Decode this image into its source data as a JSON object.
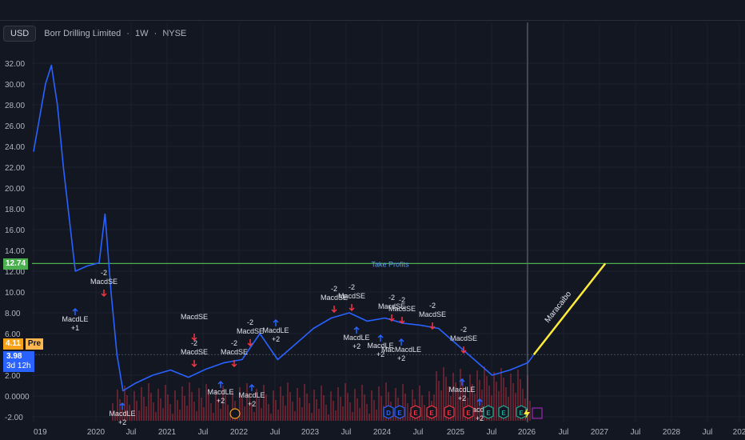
{
  "header": {
    "currency": "USD",
    "symbol_name": "Borr Drilling Limited",
    "interval": "1W",
    "exchange": "NYSE",
    "separator": "·"
  },
  "y_axis": {
    "ticks": [
      "32.00",
      "30.00",
      "28.00",
      "26.00",
      "24.00",
      "22.00",
      "20.00",
      "18.00",
      "16.00",
      "14.00",
      "12.00",
      "10.00",
      "8.00",
      "6.00",
      "2.00",
      "0.0000",
      "-2.00"
    ],
    "values": [
      32,
      30,
      28,
      26,
      24,
      22,
      20,
      18,
      16,
      14,
      12,
      10,
      8,
      6,
      2,
      0,
      -2
    ]
  },
  "x_axis": {
    "labels": [
      "019",
      "2020",
      "Jul",
      "2021",
      "Jul",
      "2022",
      "Jul",
      "2023",
      "Jul",
      "2024",
      "Jul",
      "2025",
      "Jul",
      "2026",
      "Jul",
      "2027",
      "Jul",
      "2028",
      "Jul",
      "202"
    ]
  },
  "price_tags": {
    "take_profit": "12.74",
    "prev_close": "4.11",
    "pre_label": "Pre",
    "last": "3.98",
    "countdown": "3d 12h"
  },
  "lines": {
    "take_profit_label": "Take Profits",
    "projection_label": "Maracaibo"
  },
  "colors": {
    "price_line": "#2962ff",
    "take_profit": "#4caf50",
    "projection": "#ffeb3b",
    "sell_arrow": "#f23645",
    "buy_arrow": "#2962ff",
    "background": "#131722"
  },
  "signals": [
    {
      "text": "-2",
      "sub": "MacdSE",
      "kind": "sell"
    },
    {
      "text": "MacdLE",
      "sub": "+1",
      "kind": "buy"
    },
    {
      "text": "MacdLE",
      "sub": "+2",
      "kind": "buy"
    },
    {
      "text": "-2",
      "sub": "MacdSE",
      "kind": "sell"
    },
    {
      "text": "MacdSE",
      "sub": "",
      "kind": "sell"
    },
    {
      "text": "-2",
      "sub": "MacdSE",
      "kind": "sell"
    },
    {
      "text": "-2",
      "sub": "MacdSE",
      "kind": "sell"
    },
    {
      "text": "MacdLE",
      "sub": "+2",
      "kind": "buy"
    },
    {
      "text": "MacdLE",
      "sub": "+2",
      "kind": "buy"
    },
    {
      "text": "MacdLE",
      "sub": "+2",
      "kind": "buy"
    },
    {
      "text": "-2",
      "sub": "MacdSE",
      "kind": "sell"
    },
    {
      "text": "-2",
      "sub": "MacdSE",
      "kind": "sell"
    },
    {
      "text": "MacdLE",
      "sub": "+2",
      "kind": "buy"
    },
    {
      "text": "-2",
      "sub": "MacdSE",
      "kind": "sell"
    },
    {
      "text": "-2",
      "sub": "MacdSE",
      "kind": "sell"
    },
    {
      "text": "MacdLE",
      "sub": "+2",
      "kind": "buy"
    },
    {
      "text": "MacMacdLE",
      "sub": "+2",
      "kind": "buy"
    },
    {
      "text": "-2",
      "sub": "MacdSE",
      "kind": "sell"
    },
    {
      "text": "-2",
      "sub": "MacdSE",
      "kind": "sell"
    },
    {
      "text": "MacdLE",
      "sub": "+2",
      "kind": "buy"
    },
    {
      "text": "MacdLE",
      "sub": "+2",
      "kind": "buy"
    }
  ],
  "events": [
    "D",
    "E",
    "E",
    "E",
    "E",
    "E",
    "E",
    "E",
    "E"
  ],
  "chart_data": {
    "type": "line",
    "title": "Borr Drilling Limited · 1W · NYSE",
    "series": [
      {
        "name": "",
        "x": [
          "2019-01",
          "2019-03",
          "2019-04",
          "2019-05",
          "2019-06",
          "2019-08",
          "2019-10",
          "2019-12",
          "2020-01",
          "2020-02",
          "2020-03",
          "2020-04",
          "2020-06",
          "2020-09",
          "2020-12",
          "2021-03",
          "2021-06",
          "2021-09",
          "2021-12",
          "2022-03",
          "2022-06",
          "2022-09",
          "2022-12",
          "2023-03",
          "2023-06",
          "2023-09",
          "2023-12",
          "2024-03",
          "2024-06",
          "2024-09",
          "2024-12",
          "2025-03",
          "2025-06",
          "2025-09",
          "2025-12",
          "2026-01"
        ],
        "values": [
          23.5,
          30.0,
          31.8,
          28.0,
          22.0,
          12.0,
          12.5,
          12.8,
          17.5,
          10.0,
          4.0,
          0.5,
          1.2,
          2.0,
          2.5,
          1.8,
          2.6,
          3.2,
          3.5,
          6.0,
          3.5,
          5.0,
          6.5,
          7.5,
          8.0,
          7.2,
          7.5,
          7.0,
          6.8,
          6.5,
          5.0,
          3.5,
          2.0,
          2.5,
          3.2,
          3.98
        ]
      }
    ],
    "horizontal_lines": [
      {
        "label": "Take Profits",
        "value": 12.74
      }
    ],
    "projection": {
      "label": "Maracaibo",
      "from": {
        "x": "2026-01",
        "y": 3.98
      },
      "to": {
        "x": "2027-01",
        "y": 12.74
      }
    },
    "ylim": [
      -2,
      34
    ],
    "grid": true
  }
}
